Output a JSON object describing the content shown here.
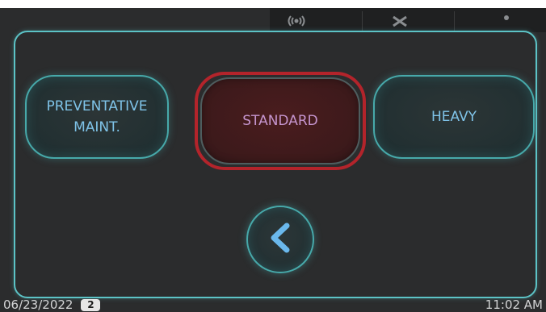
{
  "modes": [
    {
      "id": "preventative",
      "line1": "PREVENTATIVE",
      "line2": "MAINT."
    },
    {
      "id": "standard",
      "label": "STANDARD",
      "selected": true
    },
    {
      "id": "heavy",
      "label": "HEAVY"
    }
  ],
  "back_icon": "chevron-left-icon",
  "topbar_icons": [
    "wireless-signal-icon",
    "tools-icon",
    "more-icon"
  ],
  "status": {
    "date": "06/23/2022",
    "badge": "2",
    "time": "11:02 AM"
  },
  "colors": {
    "accent": "#5cc3c6",
    "selected_ring": "#b3242b",
    "label_text": "#7fc3e8",
    "selected_text": "#c494cd"
  }
}
